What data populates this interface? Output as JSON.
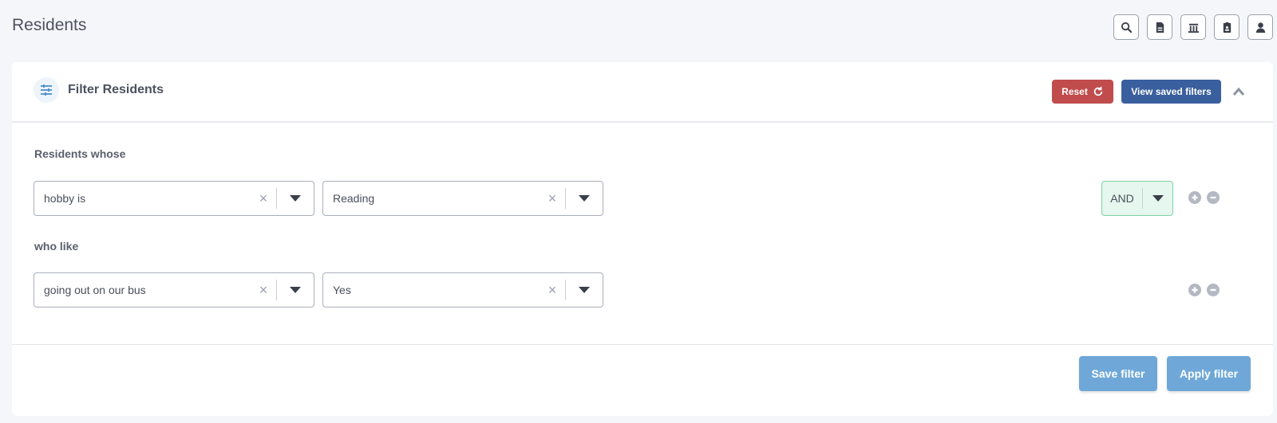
{
  "header": {
    "title": "Residents",
    "actions": [
      {
        "icon": "search-icon"
      },
      {
        "icon": "document-icon"
      },
      {
        "icon": "building-icon"
      },
      {
        "icon": "clipboard-icon"
      },
      {
        "icon": "user-icon"
      }
    ]
  },
  "filter_panel": {
    "title": "Filter Residents",
    "reset_label": "Reset",
    "saved_label": "View saved filters",
    "groups": [
      {
        "label": "Residents whose",
        "field": "hobby is",
        "value": "Reading",
        "conjunction": "AND"
      },
      {
        "label": "who like",
        "field": "going out on our bus",
        "value": "Yes"
      }
    ],
    "save_label": "Save filter",
    "apply_label": "Apply filter"
  },
  "colors": {
    "reset": "#c04c4c",
    "saved": "#3a5f9e",
    "primary_action": "#6fa8d8",
    "conjunction_bg": "#e5f7ee"
  }
}
